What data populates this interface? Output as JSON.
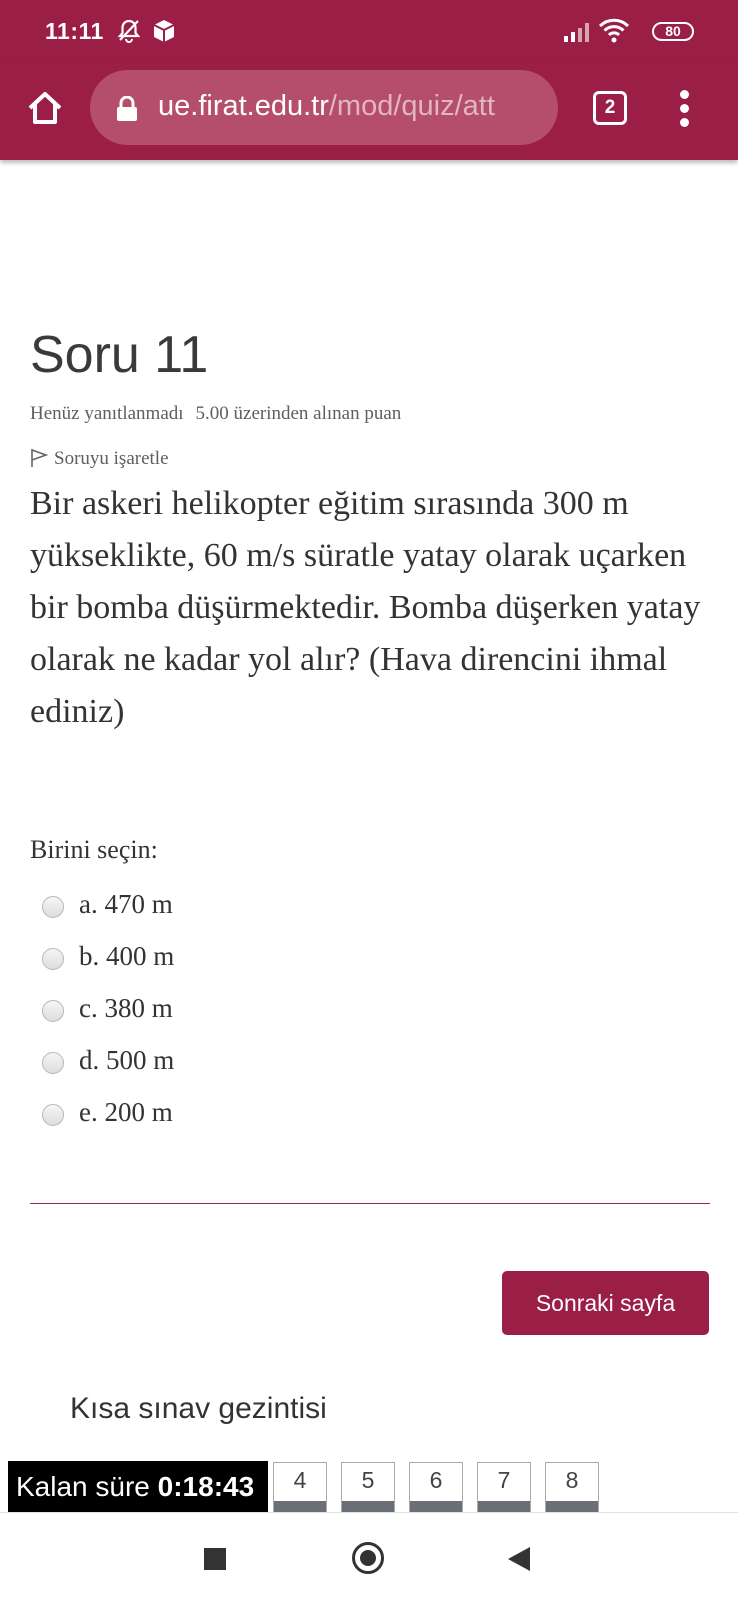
{
  "status_bar": {
    "time": "11:11",
    "battery": "80"
  },
  "browser": {
    "url_host": "ue.firat.edu.tr",
    "url_path": "/mod/quiz/att",
    "tab_count": "2"
  },
  "question": {
    "title": "Soru 11",
    "state": "Henüz yanıtlanmadı",
    "grade": "5.00 üzerinden alınan puan",
    "flag_label": "Soruyu işaretle",
    "text": "Bir askeri helikopter eğitim sırasında 300 m yükseklikte, 60 m/s süratle yatay olarak uçarken bir bomba düşürmektedir.  Bomba düşerken yatay olarak ne kadar yol alır? (Hava direncini ihmal ediniz)",
    "prompt": "Birini seçin:",
    "options": [
      "a. 470 m",
      "b. 400 m",
      "c. 380 m",
      "d. 500 m",
      "e. 200 m"
    ]
  },
  "next_button": "Sonraki sayfa",
  "quiz_nav": {
    "title": "Kısa sınav gezintisi",
    "pages": [
      "4",
      "5",
      "6",
      "7",
      "8"
    ]
  },
  "timer": {
    "label": "Kalan süre",
    "value": "0:18:43"
  },
  "colors": {
    "brand": "#9a1e45"
  }
}
